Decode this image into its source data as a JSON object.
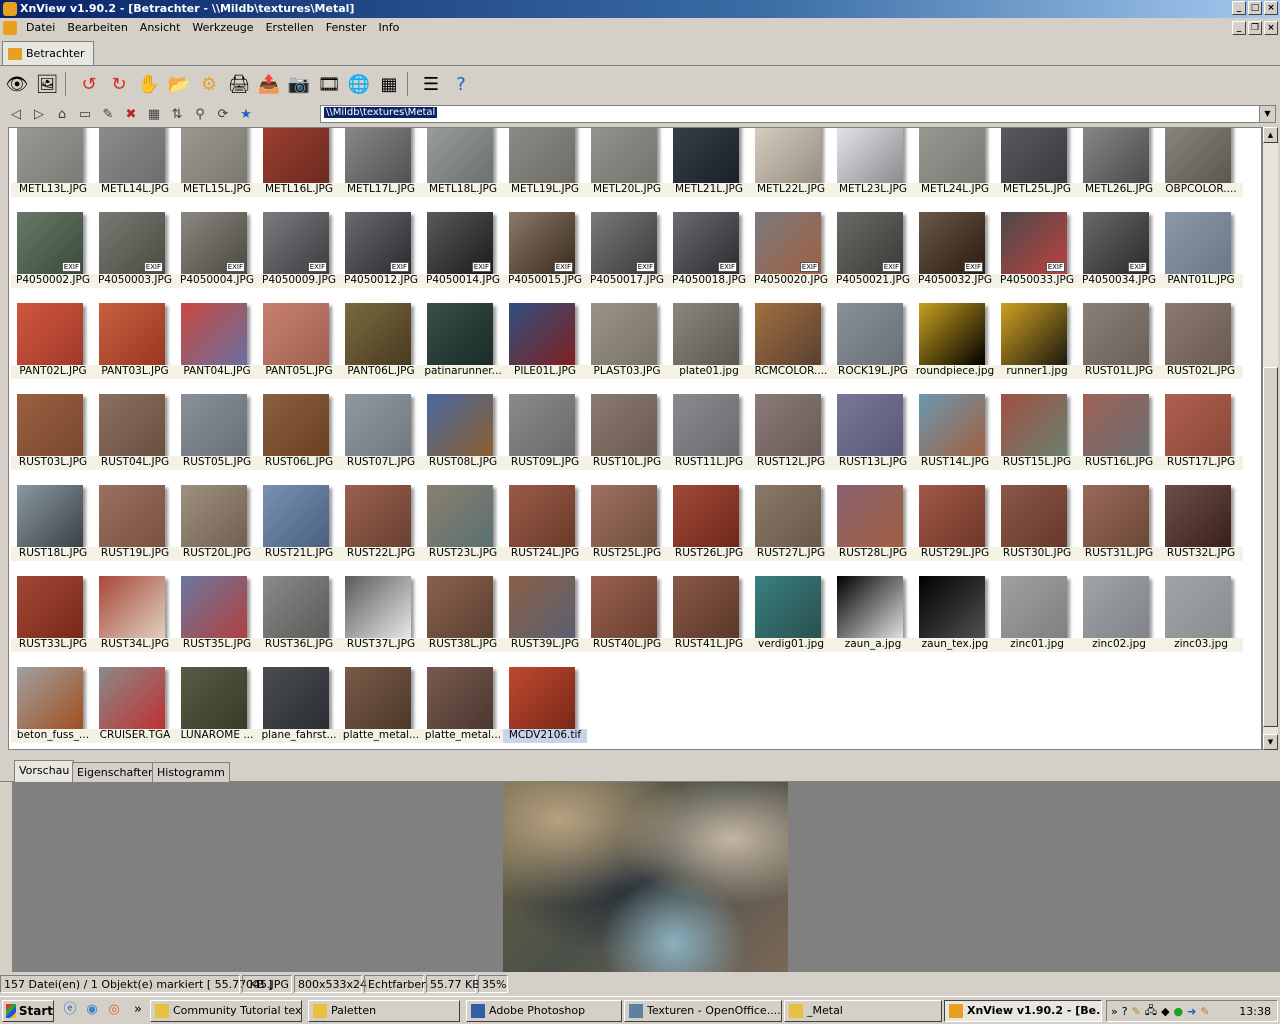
{
  "window": {
    "title": "XnView v1.90.2 - [Betrachter - \\\\Mildb\\textures\\Metal]"
  },
  "menu": [
    "Datei",
    "Bearbeiten",
    "Ansicht",
    "Werkzeuge",
    "Erstellen",
    "Fenster",
    "Info"
  ],
  "tab": {
    "label": "Betrachter"
  },
  "toolbar_icons": [
    "eye-icon",
    "picture-icon",
    "rotate-left-icon",
    "rotate-right-icon",
    "hand-icon",
    "folder-open-icon",
    "settings-icon",
    "printer-icon",
    "export-icon",
    "camera-icon",
    "filmstrip-icon",
    "globe-icon",
    "palette-icon",
    "list-icon",
    "help-icon"
  ],
  "address": {
    "path": "\\\\Mildb\\textures\\Metal"
  },
  "thumbnails": [
    {
      "name": "METL13L.JPG",
      "colors": [
        "#9a9a96",
        "#7a7a76"
      ]
    },
    {
      "name": "METL14L.JPG",
      "colors": [
        "#8c8e8c",
        "#6c6e6c"
      ]
    },
    {
      "name": "METL15L.JPG",
      "colors": [
        "#9c9a92",
        "#7a7870"
      ]
    },
    {
      "name": "METL16L.JPG",
      "colors": [
        "#a04030",
        "#6a2a20"
      ]
    },
    {
      "name": "METL17L.JPG",
      "colors": [
        "#8a8c8a",
        "#505250"
      ]
    },
    {
      "name": "METL18L.JPG",
      "colors": [
        "#9aa0a0",
        "#6a7070"
      ]
    },
    {
      "name": "METL19L.JPG",
      "colors": [
        "#8e8c86",
        "#6e6c66"
      ]
    },
    {
      "name": "METL20L.JPG",
      "colors": [
        "#949490",
        "#74746e"
      ]
    },
    {
      "name": "METL21L.JPG",
      "colors": [
        "#3a4048",
        "#1a2028"
      ]
    },
    {
      "name": "METL22L.JPG",
      "colors": [
        "#d8d0c4",
        "#988c80"
      ]
    },
    {
      "name": "METL23L.JPG",
      "colors": [
        "#e8e8ec",
        "#8a8a90"
      ]
    },
    {
      "name": "METL24L.JPG",
      "colors": [
        "#9a9a94",
        "#7a7a74"
      ]
    },
    {
      "name": "METL25L.JPG",
      "colors": [
        "#5a5a60",
        "#3a3a40"
      ]
    },
    {
      "name": "METL26L.JPG",
      "colors": [
        "#8a8a8a",
        "#4a4a4a"
      ]
    },
    {
      "name": "OBPCOLOR....",
      "colors": [
        "#8a8680",
        "#5a5650"
      ]
    },
    {
      "name": "P4050002.JPG",
      "colors": [
        "#6a7a6a",
        "#3a4a3a"
      ],
      "exif": true
    },
    {
      "name": "P4050003.JPG",
      "colors": [
        "#7a7a72",
        "#4a4a42"
      ],
      "exif": true
    },
    {
      "name": "P4050004.JPG",
      "colors": [
        "#8a8880",
        "#4a4840"
      ],
      "exif": true
    },
    {
      "name": "P4050009.JPG",
      "colors": [
        "#7a7c80",
        "#3a3c40"
      ],
      "exif": true
    },
    {
      "name": "P4050012.JPG",
      "colors": [
        "#6a6a70",
        "#2a2a30"
      ],
      "exif": true
    },
    {
      "name": "P4050014.JPG",
      "colors": [
        "#5a5a5a",
        "#1a1a1a"
      ],
      "exif": true
    },
    {
      "name": "P4050015.JPG",
      "colors": [
        "#8a7a6a",
        "#3a2a1a"
      ],
      "exif": true
    },
    {
      "name": "P4050017.JPG",
      "colors": [
        "#7a7a7a",
        "#3a3a3a"
      ],
      "exif": true
    },
    {
      "name": "P4050018.JPG",
      "colors": [
        "#6a6c70",
        "#2a2c30"
      ],
      "exif": true
    },
    {
      "name": "P4050020.JPG",
      "colors": [
        "#7a7a80",
        "#a06040"
      ],
      "exif": true
    },
    {
      "name": "P4050021.JPG",
      "colors": [
        "#6a6a66",
        "#3a3a36"
      ],
      "exif": true
    },
    {
      "name": "P4050032.JPG",
      "colors": [
        "#6a5a4a",
        "#2a1a10"
      ],
      "exif": true
    },
    {
      "name": "P4050033.JPG",
      "colors": [
        "#4a4a4a",
        "#c04040"
      ],
      "exif": true
    },
    {
      "name": "P4050034.JPG",
      "colors": [
        "#6a6a6a",
        "#2a2a2a"
      ],
      "exif": true
    },
    {
      "name": "PANT01L.JPG",
      "colors": [
        "#8a98a8",
        "#6a7888"
      ]
    },
    {
      "name": "PANT02L.JPG",
      "colors": [
        "#d05840",
        "#a03828"
      ]
    },
    {
      "name": "PANT03L.JPG",
      "colors": [
        "#c86040",
        "#983820"
      ]
    },
    {
      "name": "PANT04L.JPG",
      "colors": [
        "#c84840",
        "#6a70a0"
      ]
    },
    {
      "name": "PANT05L.JPG",
      "colors": [
        "#c88070",
        "#a06050"
      ]
    },
    {
      "name": "PANT06L.JPG",
      "colors": [
        "#7a6a40",
        "#4a3a20"
      ]
    },
    {
      "name": "patinarunner...",
      "colors": [
        "#3a5048",
        "#1a2a28"
      ]
    },
    {
      "name": "PILE01L.JPG",
      "colors": [
        "#305080",
        "#802020"
      ]
    },
    {
      "name": "PLAST03.JPG",
      "colors": [
        "#9a9488",
        "#7a7468"
      ]
    },
    {
      "name": "plate01.jpg",
      "colors": [
        "#8a8680",
        "#5a5650"
      ]
    },
    {
      "name": "RCMCOLOR....",
      "colors": [
        "#a07040",
        "#5a4030"
      ]
    },
    {
      "name": "ROCK19L.JPG",
      "colors": [
        "#8a9098",
        "#6a7078"
      ]
    },
    {
      "name": "roundpiece.jpg",
      "colors": [
        "#c8a020",
        "#000000"
      ]
    },
    {
      "name": "runner1.jpg",
      "colors": [
        "#d0a020",
        "#1a1a10"
      ]
    },
    {
      "name": "RUST01L.JPG",
      "colors": [
        "#8a8078",
        "#6a6058"
      ]
    },
    {
      "name": "RUST02L.JPG",
      "colors": [
        "#8a7a70",
        "#6a5a50"
      ]
    },
    {
      "name": "RUST03L.JPG",
      "colors": [
        "#9a6040",
        "#7a4830"
      ]
    },
    {
      "name": "RUST04L.JPG",
      "colors": [
        "#8a7060",
        "#6a5040"
      ]
    },
    {
      "name": "RUST05L.JPG",
      "colors": [
        "#8a9098",
        "#6a7078"
      ]
    },
    {
      "name": "RUST06L.JPG",
      "colors": [
        "#8a6040",
        "#6a4020"
      ]
    },
    {
      "name": "RUST07L.JPG",
      "colors": [
        "#9098a0",
        "#707880"
      ]
    },
    {
      "name": "RUST08L.JPG",
      "colors": [
        "#4a68a0",
        "#8a6030"
      ]
    },
    {
      "name": "RUST09L.JPG",
      "colors": [
        "#8a8a88",
        "#6a6a68"
      ]
    },
    {
      "name": "RUST10L.JPG",
      "colors": [
        "#8a7a70",
        "#6a5a50"
      ]
    },
    {
      "name": "RUST11L.JPG",
      "colors": [
        "#8a8a90",
        "#6a6a70"
      ]
    },
    {
      "name": "RUST12L.JPG",
      "colors": [
        "#8a7a78",
        "#6a5a58"
      ]
    },
    {
      "name": "RUST13L.JPG",
      "colors": [
        "#7a7898",
        "#5a5878"
      ]
    },
    {
      "name": "RUST14L.JPG",
      "colors": [
        "#6a98b0",
        "#a06040"
      ]
    },
    {
      "name": "RUST15L.JPG",
      "colors": [
        "#a05040",
        "#6a8070"
      ]
    },
    {
      "name": "RUST16L.JPG",
      "colors": [
        "#a06058",
        "#6a7070"
      ]
    },
    {
      "name": "RUST17L.JPG",
      "colors": [
        "#b06050",
        "#8a4838"
      ]
    },
    {
      "name": "RUST18L.JPG",
      "colors": [
        "#8a98a0",
        "#3a4048"
      ]
    },
    {
      "name": "RUST19L.JPG",
      "colors": [
        "#9a7060",
        "#7a5040"
      ]
    },
    {
      "name": "RUST20L.JPG",
      "colors": [
        "#a09080",
        "#706050"
      ]
    },
    {
      "name": "RUST21L.JPG",
      "colors": [
        "#7a90b0",
        "#4a6080"
      ]
    },
    {
      "name": "RUST22L.JPG",
      "colors": [
        "#9a6050",
        "#6a4030"
      ]
    },
    {
      "name": "RUST23L.JPG",
      "colors": [
        "#8a8070",
        "#5a7070"
      ]
    },
    {
      "name": "RUST24L.JPG",
      "colors": [
        "#9a5a48",
        "#6a3a28"
      ]
    },
    {
      "name": "RUST25L.JPG",
      "colors": [
        "#a07060",
        "#705040"
      ]
    },
    {
      "name": "RUST26L.JPG",
      "colors": [
        "#a04838",
        "#702818"
      ]
    },
    {
      "name": "RUST27L.JPG",
      "colors": [
        "#8a7868",
        "#6a5848"
      ]
    },
    {
      "name": "RUST28L.JPG",
      "colors": [
        "#8a6070",
        "#a06040"
      ]
    },
    {
      "name": "RUST29L.JPG",
      "colors": [
        "#a05848",
        "#703828"
      ]
    },
    {
      "name": "RUST30L.JPG",
      "colors": [
        "#8a5848",
        "#6a3828"
      ]
    },
    {
      "name": "RUST31L.JPG",
      "colors": [
        "#9a6858",
        "#6a4838"
      ]
    },
    {
      "name": "RUST32L.JPG",
      "colors": [
        "#6a5048",
        "#3a2018"
      ]
    },
    {
      "name": "RUST33L.JPG",
      "colors": [
        "#a04838",
        "#7a2818"
      ]
    },
    {
      "name": "RUST34L.JPG",
      "colors": [
        "#a84838",
        "#e0d0c0"
      ]
    },
    {
      "name": "RUST35L.JPG",
      "colors": [
        "#6a78a0",
        "#b04040"
      ]
    },
    {
      "name": "RUST36L.JPG",
      "colors": [
        "#8a8a88",
        "#5a5a58"
      ]
    },
    {
      "name": "RUST37L.JPG",
      "colors": [
        "#5a5a5a",
        "#e8e8e8"
      ]
    },
    {
      "name": "RUST38L.JPG",
      "colors": [
        "#8a6050",
        "#5a4030"
      ]
    },
    {
      "name": "RUST39L.JPG",
      "colors": [
        "#8a6048",
        "#5a6070"
      ]
    },
    {
      "name": "RUST40L.JPG",
      "colors": [
        "#9a6050",
        "#6a4030"
      ]
    },
    {
      "name": "RUST41L.JPG",
      "colors": [
        "#8a5848",
        "#5a3828"
      ]
    },
    {
      "name": "verdig01.jpg",
      "colors": [
        "#3a8080",
        "#2a5050"
      ]
    },
    {
      "name": "zaun_a.jpg",
      "colors": [
        "#000000",
        "#e0e0e0"
      ]
    },
    {
      "name": "zaun_tex.jpg",
      "colors": [
        "#000000",
        "#505050"
      ]
    },
    {
      "name": "zinc01.jpg",
      "colors": [
        "#a0a0a0",
        "#808080"
      ]
    },
    {
      "name": "zinc02.jpg",
      "colors": [
        "#a0a4a8",
        "#80848a"
      ]
    },
    {
      "name": "zinc03.jpg",
      "colors": [
        "#a0a4a6",
        "#8a8e90"
      ]
    },
    {
      "name": "beton_fuss_...",
      "colors": [
        "#a0a0a0",
        "#a05020"
      ]
    },
    {
      "name": "CRUISER.TGA",
      "colors": [
        "#8a8a8a",
        "#c03030"
      ]
    },
    {
      "name": "LUNAROME ...",
      "colors": [
        "#5a5a48",
        "#3a3a28"
      ]
    },
    {
      "name": "plane_fahrst...",
      "colors": [
        "#4a4e52",
        "#2a2e32"
      ]
    },
    {
      "name": "platte_metal...",
      "colors": [
        "#7a5a48",
        "#4a3828"
      ]
    },
    {
      "name": "platte_metal...",
      "colors": [
        "#7a5a50",
        "#4a3830"
      ]
    },
    {
      "name": "MCDV2106.tif",
      "colors": [
        "#c04830",
        "#7a2818"
      ],
      "selected": true
    }
  ],
  "preview_tabs": [
    "Vorschau",
    "Eigenschaften",
    "Histogramm"
  ],
  "status": {
    "files": "157 Datei(en) / 1 Objekt(e) markiert  [ 55.77 KB ]",
    "filename": "045.JPG",
    "dimensions": "800x533x24",
    "colors": "Echtfarben",
    "size": "55.77 KB",
    "zoom": "35%"
  },
  "taskbar": {
    "start": "Start",
    "tasks": [
      {
        "label": "Community Tutorial text...",
        "icon": "folder-icon"
      },
      {
        "label": "Paletten",
        "icon": "folder-icon"
      },
      {
        "label": "Adobe Photoshop",
        "icon": "photoshop-icon"
      },
      {
        "label": "Texturen - OpenOffice....",
        "icon": "document-icon"
      },
      {
        "label": "_Metal",
        "icon": "folder-icon"
      },
      {
        "label": "XnView v1.90.2 - [Be...",
        "icon": "xnview-icon",
        "active": true
      }
    ],
    "clock": "13:38",
    "chevron": "»"
  }
}
